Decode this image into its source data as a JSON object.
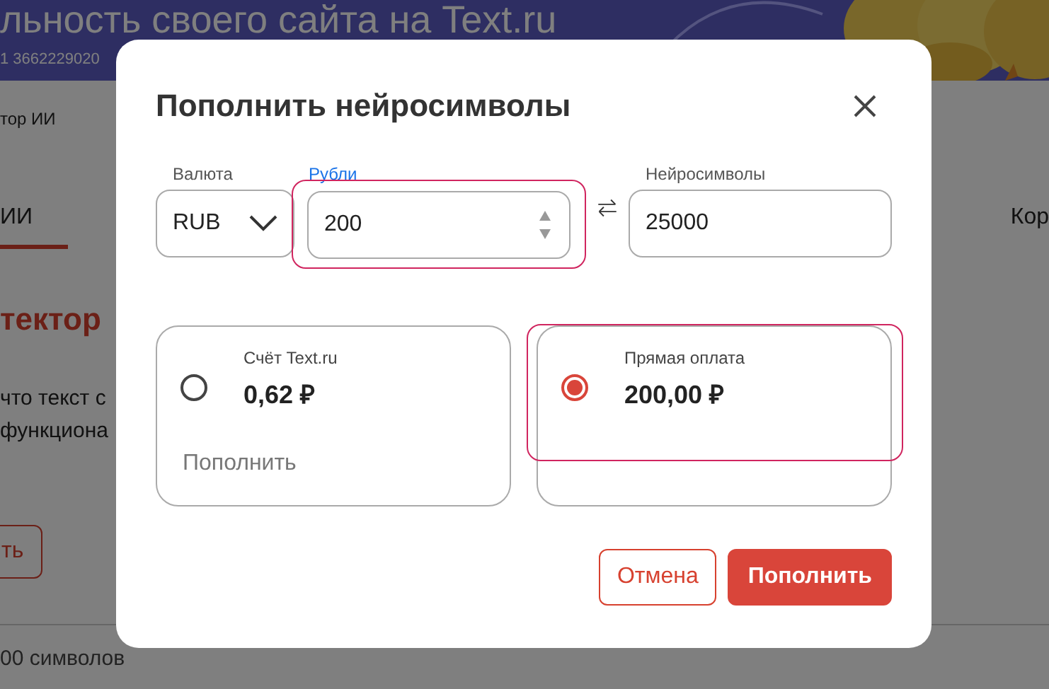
{
  "background": {
    "banner_text": "льность своего сайта на Text.ru",
    "contact": "1 3662229020",
    "breadcrumb": "тор ИИ",
    "tabs": [
      {
        "label": "ИИ",
        "selected": true
      },
      {
        "label": "Кор",
        "selected": false
      }
    ],
    "heading": "тектор",
    "text_lines": [
      "что текст с",
      "функциона"
    ],
    "button": "ть",
    "footer": "00 символов"
  },
  "dialog": {
    "title": "Пополнить нейросимволы",
    "currency": {
      "label": "Валюта",
      "value": "RUB"
    },
    "rubles": {
      "label": "Рубли",
      "value": "200",
      "highlighted": true
    },
    "neuro": {
      "label": "Нейросимволы",
      "value": "25000"
    },
    "options": [
      {
        "label": "Счёт Text.ru",
        "amount": "0,62 ₽",
        "action": "Пополнить",
        "selected": false,
        "highlighted": false
      },
      {
        "label": "Прямая оплата",
        "amount": "200,00 ₽",
        "selected": true,
        "highlighted": true
      }
    ],
    "buttons": [
      {
        "label": "Отмена",
        "kind": "secondary"
      },
      {
        "label": "Пополнить",
        "kind": "primary"
      }
    ]
  }
}
